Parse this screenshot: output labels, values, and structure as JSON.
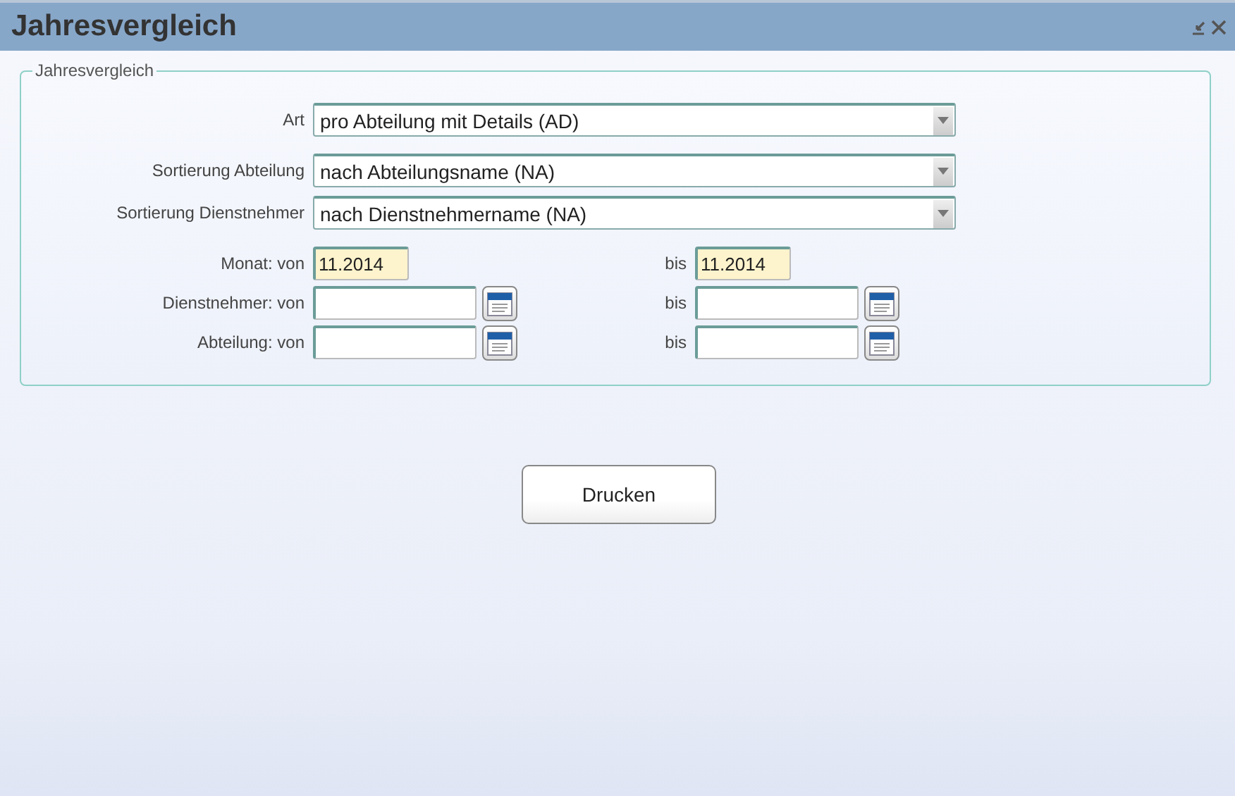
{
  "window": {
    "title": "Jahresvergleich"
  },
  "group": {
    "legend": "Jahresvergleich"
  },
  "selects": [
    {
      "label": "Art",
      "value": "pro Abteilung mit Details (AD)"
    },
    {
      "label": "Sortierung Abteilung",
      "value": "nach Abteilungsname (NA)"
    },
    {
      "label": "Sortierung Dienstnehmer",
      "value": "nach Dienstnehmername (NA)"
    }
  ],
  "ranges": [
    {
      "kind": "month",
      "label": "Monat: von",
      "from_value": "11.2014",
      "to_label": "bis",
      "to_value": "11.2014"
    },
    {
      "kind": "lookup",
      "label": "Dienstnehmer: von",
      "to_label": "bis"
    },
    {
      "kind": "lookup",
      "label": "Abteilung: von",
      "to_label": "bis"
    }
  ],
  "print_button": "Drucken"
}
